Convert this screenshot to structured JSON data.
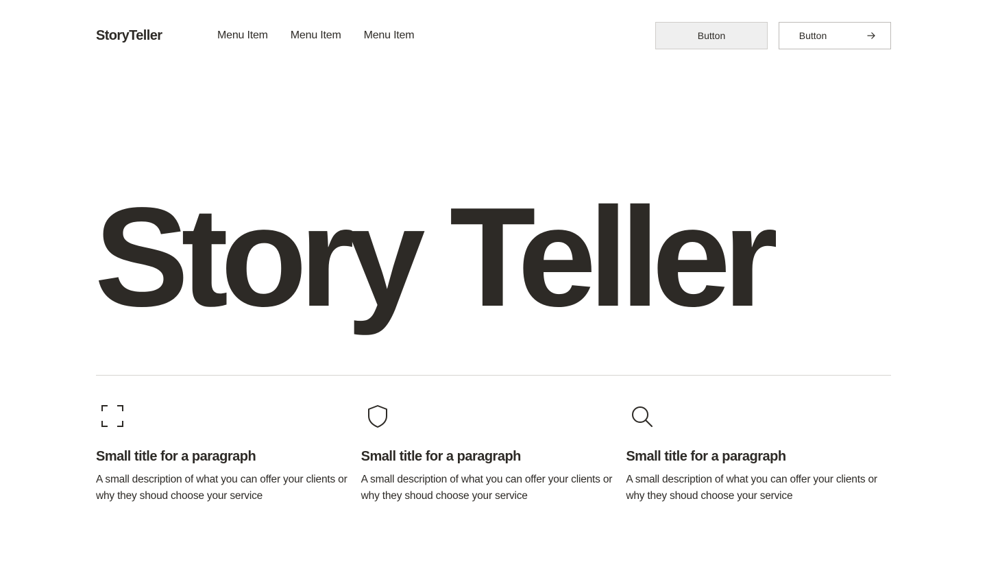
{
  "header": {
    "logo": "StoryTeller",
    "nav": [
      "Menu Item",
      "Menu Item",
      "Menu Item"
    ],
    "primary_button_label": "Button",
    "secondary_button_label": "Button",
    "secondary_button_icon": "arrow-right-icon"
  },
  "hero": {
    "title": "Story Teller"
  },
  "features": [
    {
      "icon": "expand-frame-icon",
      "title": "Small title for a paragraph",
      "description": "A small description of what you can offer your clients or why they shoud choose your service"
    },
    {
      "icon": "shield-icon",
      "title": "Small title for a paragraph",
      "description": "A small description of what you can offer your clients or why they shoud choose your service"
    },
    {
      "icon": "search-icon",
      "title": "Small title for a paragraph",
      "description": "A small description of what you can offer your clients or why they shoud choose your service"
    }
  ],
  "colors": {
    "text": "#2d2a26",
    "primary_button_bg": "#efefef",
    "border": "#bdbbb8",
    "divider": "#d6d4d1"
  }
}
